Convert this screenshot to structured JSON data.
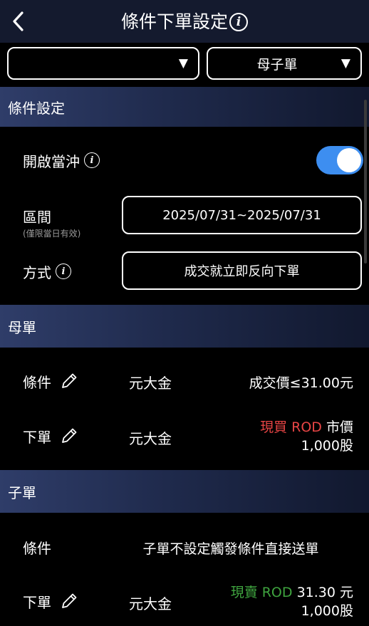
{
  "header": {
    "title": "條件下單設定",
    "info_icon": "info-icon"
  },
  "dropdowns": {
    "left_value": "",
    "right_value": "母子單",
    "caret": "▼"
  },
  "condition_settings": {
    "section_title": "條件設定",
    "day_trade_label": "開啟當沖",
    "day_trade_enabled": true,
    "period_label": "區間",
    "period_note": "(僅限當日有效)",
    "period_value": "2025/07/31~2025/07/31",
    "method_label": "方式",
    "method_value": "成交就立即反向下單"
  },
  "parent_order": {
    "section_title": "母單",
    "condition_label": "條件",
    "condition_stock": "元大金",
    "condition_value": "成交價≤31.00元",
    "order_label": "下單",
    "order_stock": "元大金",
    "order_type": "現買 ROD",
    "order_price": "市價",
    "order_qty": "1,000股"
  },
  "child_order": {
    "section_title": "子單",
    "condition_label": "條件",
    "condition_value": "子單不設定觸發條件直接送單",
    "order_label": "下單",
    "order_stock": "元大金",
    "order_type": "現賣 ROD",
    "order_price": "31.30 元",
    "order_qty": "1,000股"
  },
  "colors": {
    "header_bg": "#141a2e",
    "toggle_on": "#3d8ef0",
    "buy": "#e84545",
    "sell": "#3fa43f"
  }
}
